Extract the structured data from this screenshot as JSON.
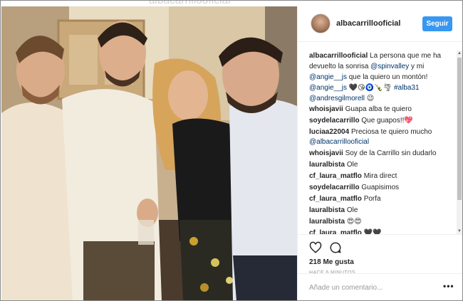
{
  "watermark": "albacarrillooficial",
  "header": {
    "username": "albacarrillooficial",
    "follow_label": "Seguir",
    "avatar_icon": "profile-avatar-icon"
  },
  "caption": {
    "author": "albacarrillooficial",
    "text1": " La persona que me ha devuelto la sonrisa ",
    "mention1": "@spinvalley",
    "text2": " y mi ",
    "mention2": "@angie__js",
    "text3": " que la quiero un montón! ",
    "mention3": "@angie__js",
    "emojis1": " 🖤😘🧿🍾🌪 ",
    "hashtag": "#alba31",
    "mention4": "@andresgilmorell",
    "emojis2": " 😉"
  },
  "comments": [
    {
      "user": "whoisjavii",
      "text": "Guapa alba te quiero"
    },
    {
      "user": "soydelacarrillo",
      "text": "Que guapos!!💖"
    },
    {
      "user": "luciaa22004",
      "text": "Preciosa te quiero mucho",
      "mention": "@albacarrillooficial"
    },
    {
      "user": "whoisjavii",
      "text": "Soy de la Carrillo sin dudarlo"
    },
    {
      "user": "lauralbista",
      "text": "Ole"
    },
    {
      "user": "cf_laura_matflo",
      "text": "Mira direct"
    },
    {
      "user": "soydelacarrillo",
      "text": "Guapisimos"
    },
    {
      "user": "cf_laura_matflo",
      "text": "Porfa"
    },
    {
      "user": "lauralbista",
      "text": "Ole"
    },
    {
      "user": "lauralbista",
      "text": "😍😍"
    },
    {
      "user": "cf_laura_matflo",
      "text": "🖤🖤"
    }
  ],
  "actions": {
    "like_icon": "heart-icon",
    "comment_icon": "comment-bubble-icon",
    "likes": "218 Me gusta",
    "time": "HACE 6 MINUTOS"
  },
  "add_comment": {
    "placeholder": "Añade un comentario...",
    "more_label": "•••"
  }
}
